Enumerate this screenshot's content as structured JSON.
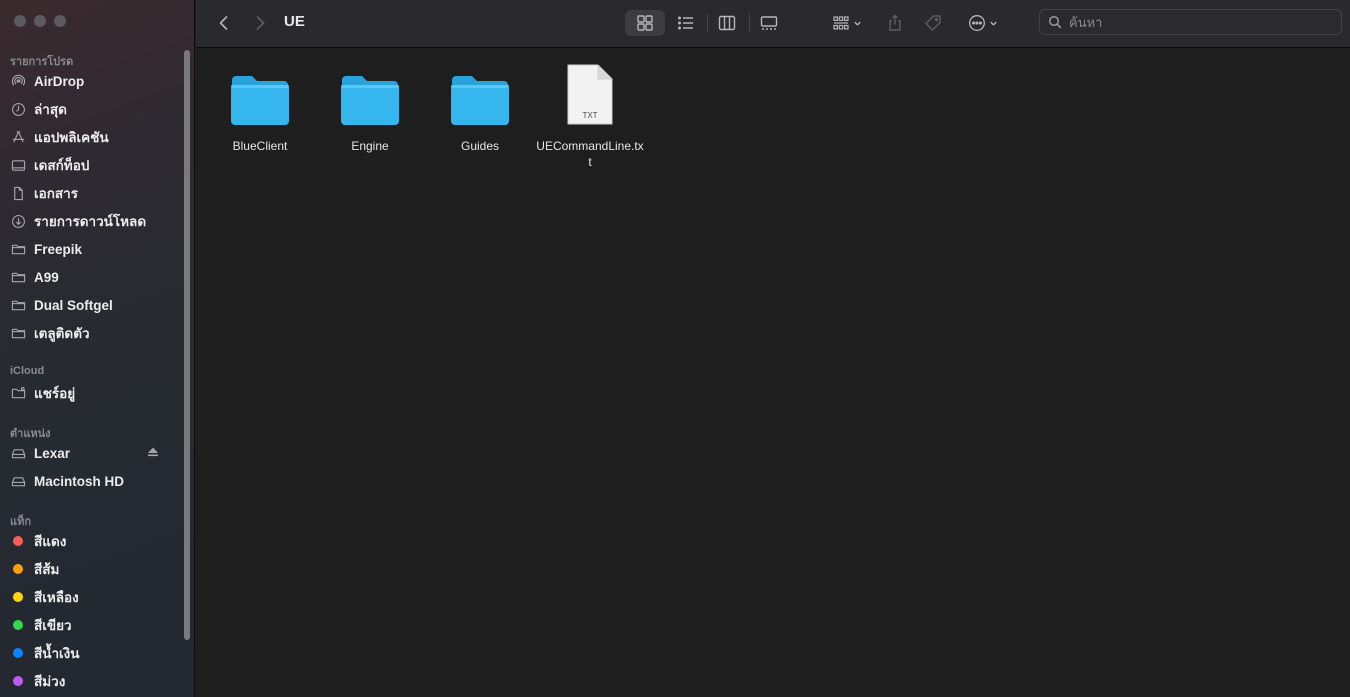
{
  "window": {
    "title": "UE"
  },
  "sidebar": {
    "favorites_header": "รายการโปรด",
    "favorites": [
      {
        "label": "AirDrop",
        "icon": "airdrop-icon"
      },
      {
        "label": "ล่าสุด",
        "icon": "clock-icon"
      },
      {
        "label": "แอปพลิเคชัน",
        "icon": "applications-icon"
      },
      {
        "label": "เดสก์ท็อป",
        "icon": "desktop-icon"
      },
      {
        "label": "เอกสาร",
        "icon": "document-icon"
      },
      {
        "label": "รายการดาวน์โหลด",
        "icon": "download-icon"
      },
      {
        "label": "Freepik",
        "icon": "folder-icon"
      },
      {
        "label": "A99",
        "icon": "folder-icon"
      },
      {
        "label": "Dual Softgel",
        "icon": "folder-icon"
      },
      {
        "label": "เตลูติดตัว",
        "icon": "folder-icon"
      }
    ],
    "icloud_header": "iCloud",
    "icloud": [
      {
        "label": "แชร์อยู่",
        "icon": "shared-folder-icon"
      }
    ],
    "locations_header": "ตำแหน่ง",
    "locations": [
      {
        "label": "Lexar",
        "icon": "drive-icon",
        "ejectable": true
      },
      {
        "label": "Macintosh HD",
        "icon": "drive-icon"
      }
    ],
    "tags_header": "แท็ก",
    "tags": [
      {
        "label": "สีแดง",
        "color": "#ff5c55"
      },
      {
        "label": "สีส้ม",
        "color": "#ff9f0a"
      },
      {
        "label": "สีเหลือง",
        "color": "#ffd60a"
      },
      {
        "label": "สีเขียว",
        "color": "#32d74b"
      },
      {
        "label": "สีน้ำเงิน",
        "color": "#0a84ff"
      },
      {
        "label": "สีม่วง",
        "color": "#bf5af2"
      }
    ]
  },
  "toolbar": {
    "view_modes": [
      "icon-view",
      "list-view",
      "column-view",
      "gallery-view"
    ],
    "active_view": "icon-view",
    "search_placeholder": "ค้นหา"
  },
  "files": [
    {
      "name": "BlueClient",
      "kind": "folder"
    },
    {
      "name": "Engine",
      "kind": "folder"
    },
    {
      "name": "Guides",
      "kind": "folder"
    },
    {
      "name": "UECommandLine.txt",
      "kind": "txt",
      "badge": "TXT"
    }
  ],
  "colors": {
    "folder": "#35b6ee",
    "folder_tab": "#29a3dc",
    "accent": "#0a84ff"
  }
}
